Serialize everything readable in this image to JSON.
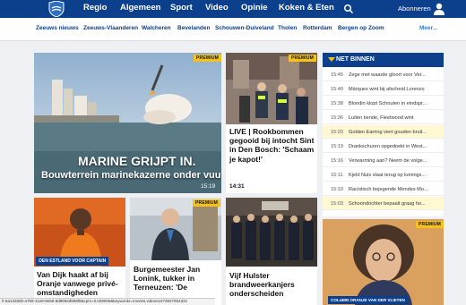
{
  "nav": {
    "items": [
      "Regio",
      "Algemeen",
      "Sport",
      "Video",
      "Opinie",
      "Koken & Eten"
    ],
    "subscribe_label": "Abonneren"
  },
  "subnav": {
    "items": [
      "Zeeuws nieuws",
      "Zeeuws-Vlaanderen",
      "Walcheren",
      "Bevelanden",
      "Schouwen-Duiveland",
      "Tholen",
      "Rotterdam",
      "Bergen op Zoom"
    ],
    "more_label": "Meer..."
  },
  "hero": {
    "premium": "PREMIUM",
    "headline": "MARINE GRIJPT IN.",
    "subheadline": "Bouwterrein marinekazerne onder vuur",
    "time": "15:19"
  },
  "live": {
    "premium": "PREMIUM",
    "title": "LIVE | Rookbommen gegooid bij intocht Sint in Den Bosch: 'Schaam je kapot!'",
    "time": "14:31"
  },
  "dijk": {
    "tag": "OEN ESTLAND VOOR CAPTAIN",
    "title": "Van Dijk haakt af bij Oranje vanwege privé-omstandigheden"
  },
  "burgemeester": {
    "premium": "PREMIUM",
    "title": "Burgemeester Jan Lonink, tukker in Terneuzen: 'De"
  },
  "hulster": {
    "title": "Vijf Hulster brandweerkanjers onderscheiden"
  },
  "columnist": {
    "premium": "PREMIUM",
    "tag": "COLUMN ORANJE VAN DER VLIETEN"
  },
  "net_binnen": {
    "title": "NET BINNEN",
    "items": [
      {
        "time": "15:45",
        "text": "Zege met waarde gloort voor Ver..."
      },
      {
        "time": "15:40",
        "text": "Márquez wint bij afscheid Lorenzo"
      },
      {
        "time": "15:38",
        "text": "Blondin klopt Schouten in eindspr..."
      },
      {
        "time": "15:36",
        "text": "Luiten tiende, Fleetwood wint"
      },
      {
        "time": "15:20",
        "text": "Golden Earring viert gouden bruil..."
      },
      {
        "time": "15:19",
        "text": "Drankschuren opgedoekt in West..."
      },
      {
        "time": "15:16",
        "text": "Verwarming aan? Neem de volge..."
      },
      {
        "time": "15:11",
        "text": "Kjeld Nuis slaat terug op konings..."
      },
      {
        "time": "15:10",
        "text": "Racistisch bejegende Mendes Mo..."
      },
      {
        "time": "15:03",
        "text": "Schoondochter bepaalt graag ho..."
      }
    ]
  },
  "status_text": "h-5a1328d0-a7b8-11e8-8e56-8d8592d868f6&cpm=0.028008&keywords=movies,videos1573927964321",
  "colors": {
    "brand": "#0c3f8c",
    "premium": "#f6c21a",
    "link": "#2c7fd1"
  }
}
